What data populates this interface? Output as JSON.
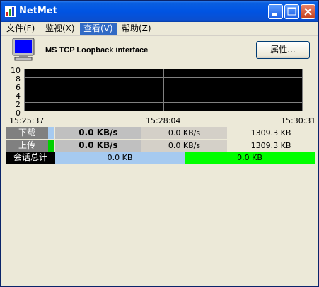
{
  "window": {
    "title": "NetMet"
  },
  "menu": [
    {
      "label": "文件(F)"
    },
    {
      "label": "监视(X)"
    },
    {
      "label": "查看(V)"
    },
    {
      "label": "帮助(Z)"
    }
  ],
  "interface": {
    "name": "MS TCP Loopback interface",
    "properties_label": "属性..."
  },
  "chart_data": {
    "type": "line",
    "title": "",
    "xlabel": "",
    "ylabel": "",
    "ylim": [
      0,
      10
    ],
    "y_ticks": [
      "10",
      "8",
      "6",
      "4",
      "2",
      "0"
    ],
    "x_ticks": [
      "15:25:37",
      "15:28:04",
      "15:30:31"
    ],
    "grid": true,
    "series": []
  },
  "stats": {
    "download": {
      "label": "下载",
      "current": "0.0 KB/s",
      "average": "0.0 KB/s",
      "total": "1309.3 KB"
    },
    "upload": {
      "label": "上传",
      "current": "0.0 KB/s",
      "average": "0.0 KB/s",
      "total": "1309.3 KB"
    },
    "session": {
      "label": "会话总计",
      "received": "0.0 KB",
      "sent": "0.0 KB"
    }
  },
  "colors": {
    "download": "#a6caf0",
    "upload": "#00d000",
    "session_sent": "#00ff00",
    "plot_bg": "#000000",
    "grid": "#808080"
  }
}
